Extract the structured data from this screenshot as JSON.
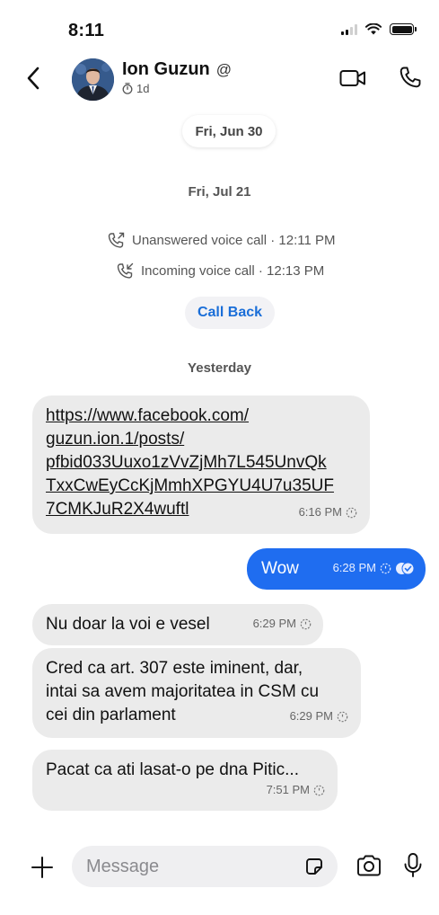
{
  "status_bar": {
    "time": "8:11"
  },
  "header": {
    "contact_name": "Ion Guzun",
    "name_badge": "@",
    "disappearing_timer": "1d"
  },
  "thread": {
    "date_chip_1": "Fri, Jun 30",
    "date_label_2": "Fri, Jul 21",
    "call_1": "Unanswered voice call · 12:11 PM",
    "call_2": "Incoming voice call · 12:13 PM",
    "call_back_label": "Call Back",
    "date_label_3": "Yesterday",
    "messages": [
      {
        "direction": "incoming",
        "lines": [
          "https://www.facebook.com/",
          "guzun.ion.1/posts/",
          "pfbid033Uuxo1zVvZjMh7L545UnvQk",
          "TxxCwEyCcKjMmhXPGYU4U7u35UF",
          "7CMKJuR2X4wuftl"
        ],
        "time": "6:16 PM"
      },
      {
        "direction": "outgoing",
        "text": "Wow",
        "time": "6:28 PM"
      },
      {
        "direction": "incoming",
        "text": "Nu doar la voi e vesel",
        "time": "6:29 PM"
      },
      {
        "direction": "incoming",
        "lines": [
          "Cred ca art. 307 este iminent, dar,",
          "intai sa avem majoritatea in CSM cu",
          "cei din parlament"
        ],
        "time": "6:29 PM"
      },
      {
        "direction": "incoming",
        "text": "Pacat ca ati lasat-o pe dna Pitic...",
        "time": "7:51 PM"
      }
    ]
  },
  "composer": {
    "placeholder": "Message"
  },
  "colors": {
    "outgoing_bubble": "#1f6df0",
    "incoming_bubble": "#ebebeb",
    "link_accent": "#1a6ed8"
  }
}
